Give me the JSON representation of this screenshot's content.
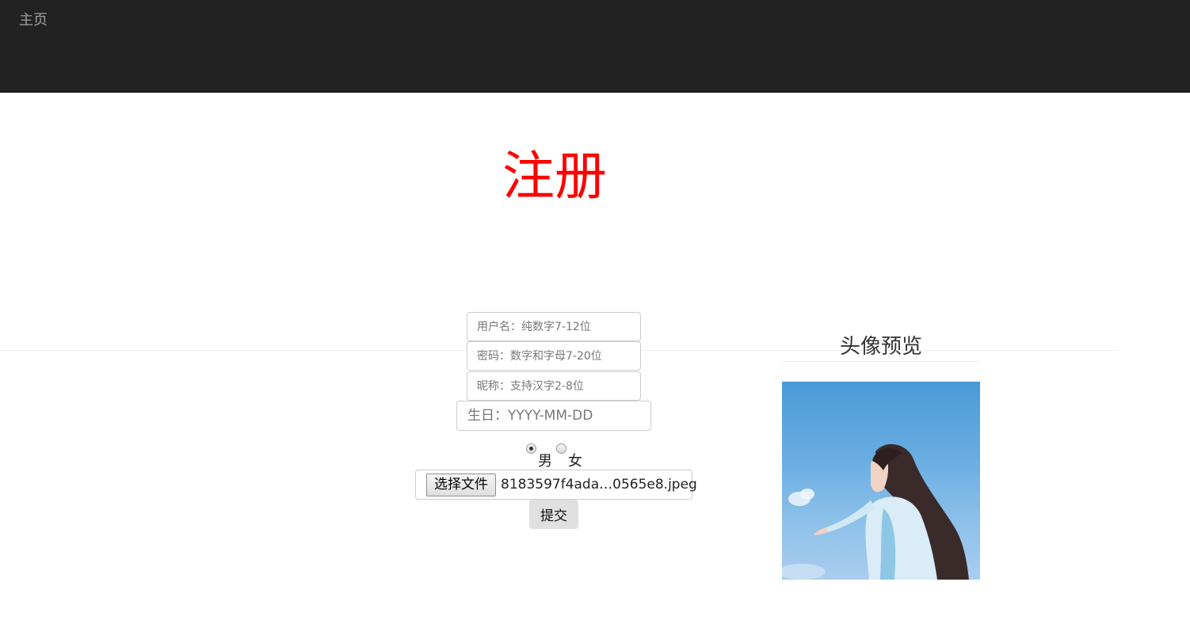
{
  "nav": {
    "home_label": "主页"
  },
  "page": {
    "title": "注册"
  },
  "form": {
    "username_placeholder": "用户名：纯数字7-12位",
    "password_placeholder": "密码：数字和字母7-20位",
    "nickname_placeholder": "昵称：支持汉字2-8位",
    "birthday_placeholder": "生日：YYYY-MM-DD",
    "gender": {
      "male_label": "男",
      "female_label": "女",
      "selected": "男"
    },
    "file": {
      "button_label": "选择文件",
      "file_name": "8183597f4ada…0565e8.jpeg"
    },
    "submit_label": "提交"
  },
  "preview": {
    "title": "头像预览"
  },
  "colors": {
    "navbar": "#222222",
    "title": "#ff0000",
    "nav_text": "#9d9d9d"
  }
}
